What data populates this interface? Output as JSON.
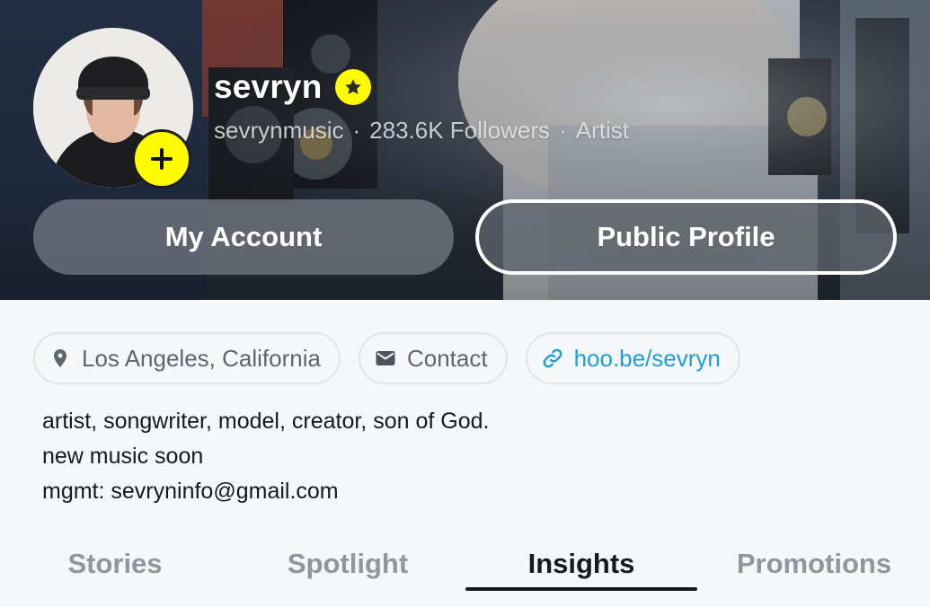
{
  "profile": {
    "display_name": "sevryn",
    "username": "sevrynmusic",
    "followers": "283.6K Followers",
    "category": "Artist",
    "separator": "·"
  },
  "header": {
    "my_account_label": "My Account",
    "public_profile_label": "Public Profile"
  },
  "chips": {
    "location": "Los Angeles, California",
    "contact": "Contact",
    "link": "hoo.be/sevryn"
  },
  "bio": {
    "line1": "artist, songwriter, model, creator, son of God.",
    "line2": "new music soon",
    "line3": "mgmt: sevryninfo@gmail.com"
  },
  "tabs": {
    "stories": "Stories",
    "spotlight": "Spotlight",
    "insights": "Insights",
    "promotions": "Promotions",
    "active": "Insights"
  },
  "colors": {
    "accent_yellow": "#fffc00",
    "link_blue": "#1c9fd9",
    "active_text": "#16191d",
    "inactive_tab": "#8f969e"
  },
  "icons": {
    "avatar_add": "plus-icon",
    "verified": "star-icon",
    "location": "map-pin-icon",
    "contact": "envelope-icon",
    "link": "link-icon"
  }
}
